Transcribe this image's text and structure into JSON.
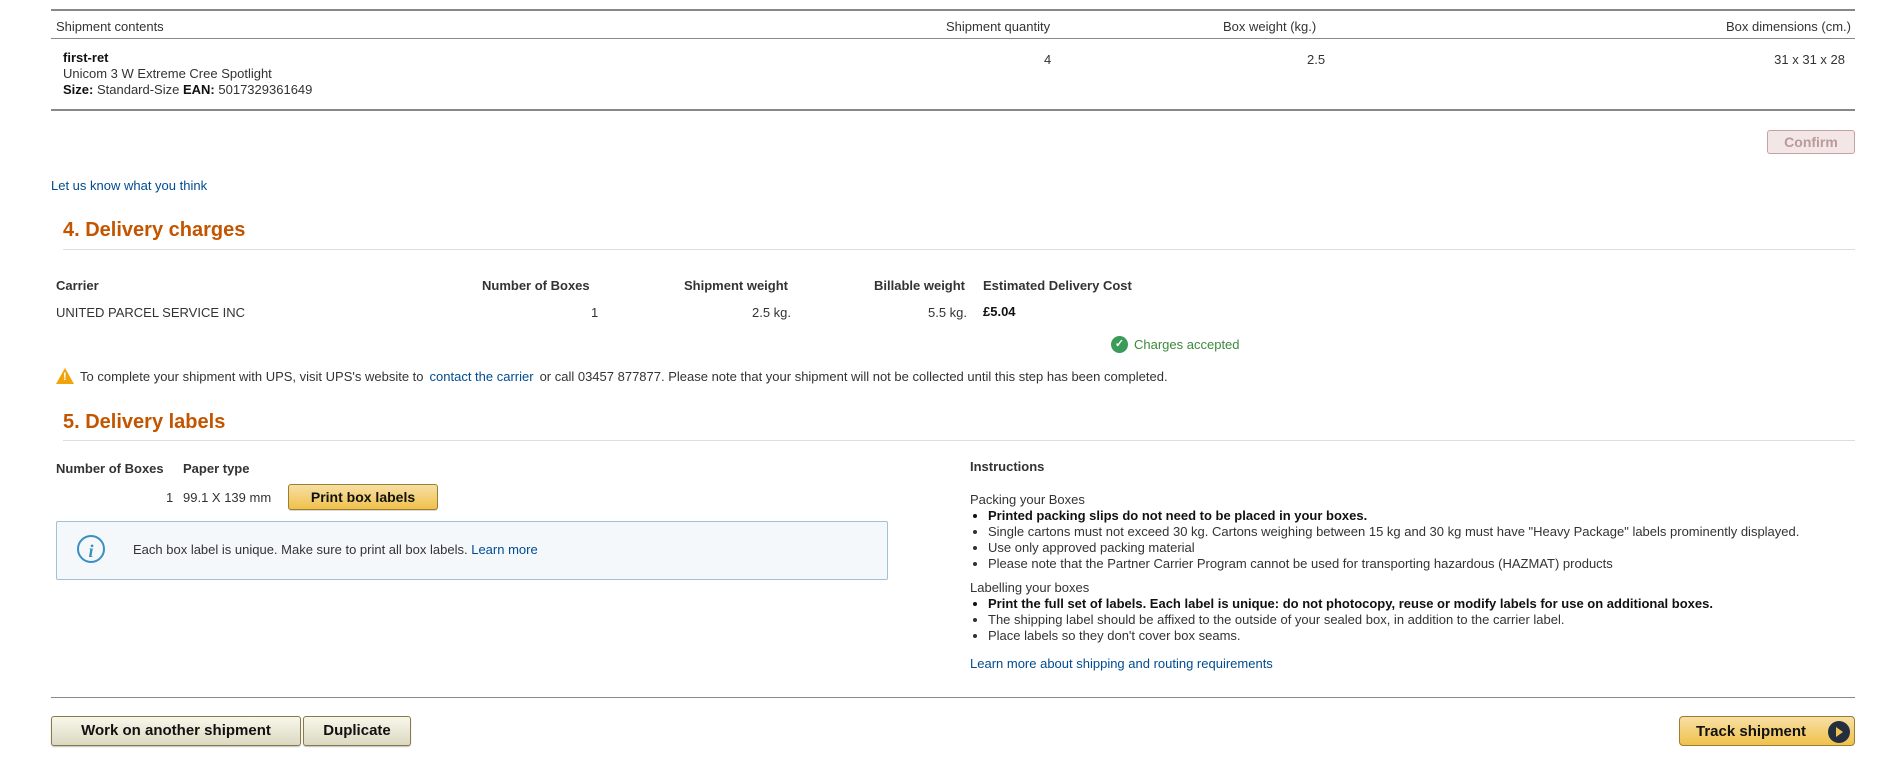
{
  "shipment_contents": {
    "headers": {
      "contents": "Shipment contents",
      "quantity": "Shipment quantity",
      "weight": "Box weight (kg.)",
      "dimensions": "Box dimensions (cm.)"
    },
    "item": {
      "sku": "first-ret",
      "title": "Unicom 3 W Extreme Cree Spotlight",
      "size_label": "Size:",
      "size_value": "Standard-Size",
      "ean_label": "EAN:",
      "ean_value": "5017329361649",
      "quantity": "4",
      "weight": "2.5",
      "dimensions": "31 x 31 x 28"
    },
    "confirm_label": "Confirm"
  },
  "feedback_link": "Let us know what you think",
  "delivery_charges": {
    "title": "4. Delivery charges",
    "headers": {
      "carrier": "Carrier",
      "boxes": "Number of Boxes",
      "shipment_weight": "Shipment weight",
      "billable_weight": "Billable weight",
      "cost": "Estimated Delivery Cost"
    },
    "row": {
      "carrier": "UNITED PARCEL SERVICE INC",
      "boxes": "1",
      "shipment_weight": "2.5 kg.",
      "billable_weight": "5.5 kg.",
      "cost": "£5.04"
    },
    "status": "Charges accepted",
    "status_color": "#3b8a3b",
    "warning": {
      "before": "To complete your shipment with UPS, visit UPS's website to",
      "link": "contact the carrier",
      "after": "or call 03457 877877. Please note that your shipment will not be collected until this step has been completed."
    }
  },
  "delivery_labels": {
    "title": "5. Delivery labels",
    "headers": {
      "boxes": "Number of Boxes",
      "paper": "Paper type"
    },
    "row": {
      "boxes": "1",
      "paper": "99.1 X 139 mm"
    },
    "print_label": "Print box labels",
    "info": {
      "text": "Each box label is unique. Make sure to print all box labels.",
      "link": "Learn more"
    },
    "instructions": {
      "title": "Instructions",
      "packing_title": "Packing your Boxes",
      "packing": [
        {
          "text": "Printed packing slips do not need to be placed in your boxes.",
          "bold": true
        },
        {
          "text": "Single cartons must not exceed 30 kg. Cartons weighing between 15 kg and 30 kg must have \"Heavy Package\" labels prominently displayed.",
          "bold": false
        },
        {
          "text": "Use only approved packing material",
          "bold": false
        },
        {
          "text": "Please note that the Partner Carrier Program cannot be used for transporting hazardous (HAZMAT) products",
          "bold": false
        }
      ],
      "labelling_title": "Labelling your boxes",
      "labelling": [
        {
          "text": "Print the full set of labels. Each label is unique: do not photocopy, reuse or modify labels for use on additional boxes.",
          "bold": true
        },
        {
          "text": "The shipping label should be affixed to the outside of your sealed box, in addition to the carrier label.",
          "bold": false
        },
        {
          "text": "Place labels so they don't cover box seams.",
          "bold": false
        }
      ],
      "more_link": "Learn more about shipping and routing requirements"
    }
  },
  "footer": {
    "work_another": "Work on another shipment",
    "duplicate": "Duplicate",
    "track": "Track shipment"
  },
  "colors": {
    "section_title": "#c45500",
    "link": "#004b91",
    "button_yellow": "#f0c14b"
  }
}
